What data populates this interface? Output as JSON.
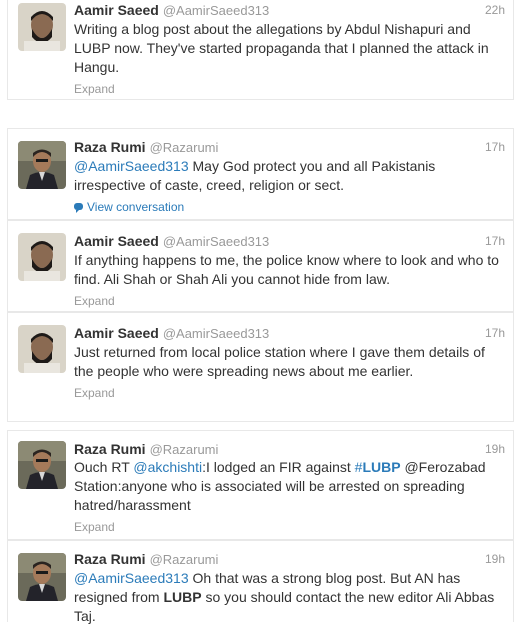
{
  "tweets": [
    {
      "name": "Aamir Saeed",
      "handle": "@AamirSaeed313",
      "time": "22h",
      "avatar": "aamir",
      "text": "Writing a blog post about the allegations by Abdul Nishapuri and LUBP now. They've started propaganda that I planned the attack in Hangu.",
      "footer": "Expand"
    },
    {
      "name": "Raza Rumi",
      "handle": "@Razarumi",
      "time": "17h",
      "avatar": "raza",
      "mention": "@AamirSaeed313",
      "text": " May God protect you and all Pakistanis irrespective of caste, creed, religion or sect.",
      "footer": "View conversation"
    },
    {
      "name": "Aamir Saeed",
      "handle": "@AamirSaeed313",
      "time": "17h",
      "avatar": "aamir",
      "text": "If anything happens to me, the police know where to look and who to find. Ali Shah or Shah Ali you cannot hide from law.",
      "footer": "Expand"
    },
    {
      "name": "Aamir Saeed",
      "handle": "@AamirSaeed313",
      "time": "17h",
      "avatar": "aamir",
      "text": "Just returned from local police station where I gave them details of the people who were spreading news about me earlier.",
      "footer": "Expand"
    },
    {
      "name": "Raza Rumi",
      "handle": "@Razarumi",
      "time": "19h",
      "avatar": "raza",
      "text_a": "Ouch RT ",
      "mention": "@akchishti",
      "text_b": ":I lodged an FIR against ",
      "hashtag_mark": "#",
      "hashtag": "LUBP",
      "text_c": " @Ferozabad Station:anyone who is associated will be arrested on spreading hatred/harassment",
      "footer": "Expand"
    },
    {
      "name": "Raza Rumi",
      "handle": "@Razarumi",
      "time": "19h",
      "avatar": "raza",
      "mention": "@AamirSaeed313",
      "text_a": " Oh that was a strong blog post. But AN has resigned from ",
      "bold": "LUBP",
      "text_b": " so you should contact the new editor Ali Abbas Taj."
    }
  ],
  "colors": {
    "link": "#2b7bb9",
    "muted": "#999999",
    "text": "#333333",
    "border": "#e8e8e8"
  }
}
